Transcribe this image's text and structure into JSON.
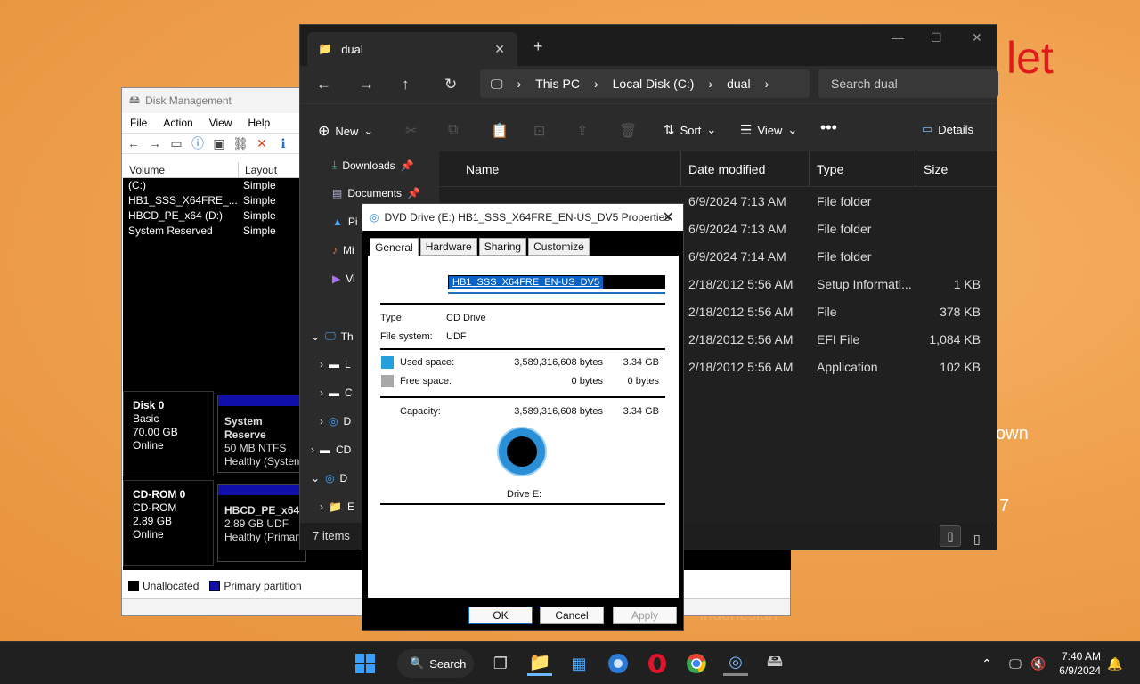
{
  "background": {
    "fragments": [
      "let",
      "own",
      "7",
      "Indonesian”"
    ]
  },
  "disk_mgmt": {
    "title": "Disk Management",
    "menu": [
      "File",
      "Action",
      "View",
      "Help"
    ],
    "columns": [
      "Volume",
      "Layout"
    ],
    "volumes": [
      {
        "name": "(C:)",
        "layout": "Simple"
      },
      {
        "name": "HB1_SSS_X64FRE_...",
        "layout": "Simple"
      },
      {
        "name": "HBCD_PE_x64 (D:)",
        "layout": "Simple"
      },
      {
        "name": "System Reserved",
        "layout": "Simple"
      }
    ],
    "disks": [
      {
        "name": "Disk 0",
        "type": "Basic",
        "size": "70.00 GB",
        "state": "Online",
        "part_name": "System Reserve",
        "part_fs": "50 MB NTFS",
        "part_health": "Healthy (System"
      },
      {
        "name": "CD-ROM 0",
        "type": "CD-ROM",
        "size": "2.89 GB",
        "state": "Online",
        "part_name": "HBCD_PE_x64",
        "part_fs": "2.89 GB UDF",
        "part_health": "Healthy (Primary"
      }
    ],
    "legend": [
      "Unallocated",
      "Primary partition"
    ]
  },
  "explorer": {
    "tab": "dual",
    "breadcrumbs": [
      "This PC",
      "Local Disk (C:)",
      "dual"
    ],
    "search_placeholder": "Search dual",
    "commands": {
      "new": "New",
      "sort": "Sort",
      "view": "View",
      "details": "Details"
    },
    "nav": {
      "downloads": "Downloads",
      "documents": "Documents",
      "pi": "Pi",
      "mi": "Mi",
      "vi": "Vi",
      "th": "Th",
      "l": "L",
      "c1": "C",
      "d": "D",
      "cd": "CD",
      "dv": "D",
      "e": "E"
    },
    "columns": [
      "Name",
      "Date modified",
      "Type",
      "Size"
    ],
    "rows": [
      {
        "date": "6/9/2024 7:13 AM",
        "type": "File folder",
        "size": ""
      },
      {
        "date": "6/9/2024 7:13 AM",
        "type": "File folder",
        "size": ""
      },
      {
        "date": "6/9/2024 7:14 AM",
        "type": "File folder",
        "size": ""
      },
      {
        "date": "2/18/2012 5:56 AM",
        "type": "Setup Informati...",
        "size": "1 KB"
      },
      {
        "date": "2/18/2012 5:56 AM",
        "type": "File",
        "size": "378 KB"
      },
      {
        "date": "2/18/2012 5:56 AM",
        "type": "EFI File",
        "size": "1,084 KB"
      },
      {
        "date": "2/18/2012 5:56 AM",
        "type": "Application",
        "size": "102 KB"
      }
    ],
    "status": "7 items"
  },
  "dialog": {
    "title": "DVD Drive (E:) HB1_SSS_X64FRE_EN-US_DV5 Properties",
    "tabs": [
      "General",
      "Hardware",
      "Sharing",
      "Customize"
    ],
    "name": "HB1_SSS_X64FRE_EN-US_DV5",
    "type_label": "Type:",
    "type_value": "CD Drive",
    "fs_label": "File system:",
    "fs_value": "UDF",
    "used_label": "Used space:",
    "used_bytes": "3,589,316,608 bytes",
    "used_gb": "3.34 GB",
    "free_label": "Free space:",
    "free_bytes": "0 bytes",
    "free_gb": "0 bytes",
    "cap_label": "Capacity:",
    "cap_bytes": "3,589,316,608 bytes",
    "cap_gb": "3.34 GB",
    "drive_label": "Drive E:",
    "buttons": {
      "ok": "OK",
      "cancel": "Cancel",
      "apply": "Apply"
    },
    "colors": {
      "used": "#26a0da",
      "free": "#a8a8a8"
    }
  },
  "taskbar": {
    "search": "Search",
    "time": "7:40 AM",
    "date": "6/9/2024"
  }
}
